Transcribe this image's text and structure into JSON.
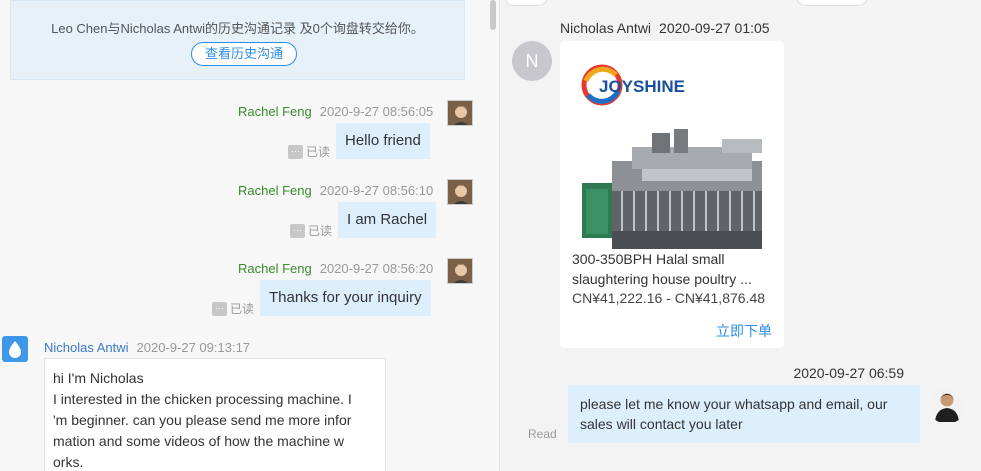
{
  "history": {
    "text": "Leo Chen与Nicholas Antwi的历史沟通记录 及0个询盘转交给你。",
    "button": "查看历史沟通"
  },
  "left_messages": [
    {
      "name": "Rachel Feng",
      "time": "2020-9-27 08:56:05",
      "text": "Hello friend",
      "status": "已读"
    },
    {
      "name": "Rachel Feng",
      "time": "2020-9-27 08:56:10",
      "text": "I am Rachel",
      "status": "已读"
    },
    {
      "name": "Rachel Feng",
      "time": "2020-9-27 08:56:20",
      "text": "Thanks for your inquiry",
      "status": "已读"
    }
  ],
  "dots_label": "···",
  "customer_message": {
    "name": "Nicholas Antwi",
    "time": "2020-9-27 09:13:17",
    "lines": [
      "hi I'm Nicholas",
      "I interested in the chicken processing machine. I",
      "'m beginner. can you please send me more infor",
      "mation and some videos of how the machine w",
      "orks."
    ]
  },
  "right": {
    "card_sender": "Nicholas Antwi",
    "card_time": "2020-09-27 01:05",
    "avatar_letter": "N",
    "logo_text": "JOYSHINE",
    "product_title": "300-350BPH Halal small slaughtering house poultry ...",
    "product_price": "CN¥41,222.16 - CN¥41,876.48",
    "order_label": "立即下单",
    "reply_time": "2020-09-27 06:59",
    "reply_text": "please let me know your whatsapp and email, our sales will contact you later",
    "reply_status": "Read"
  },
  "colors": {
    "accent_blue": "#2d8ce6",
    "sender_green": "#3a8b2e",
    "bubble_blue": "#ddeefc"
  }
}
